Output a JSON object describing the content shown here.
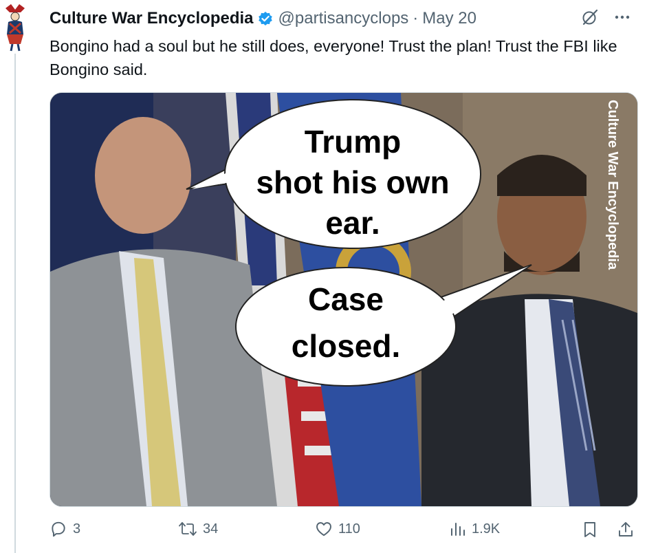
{
  "tweet": {
    "author_name": "Culture War Encyclopedia",
    "handle": "@partisancyclops",
    "separator": "·",
    "date": "May 20",
    "text": "Bongino had a soul but he still does, everyone! Trust the plan! Trust the FBI like Bongino said.",
    "verified": true,
    "accent_color": "#1d9bf0"
  },
  "media": {
    "watermark": "Culture War Encyclopedia",
    "bubble_1": [
      "Trump",
      "shot his own",
      "ear."
    ],
    "bubble_2": [
      "Case",
      "closed."
    ]
  },
  "actions": {
    "replies": "3",
    "reposts": "34",
    "likes": "110",
    "views": "1.9K"
  },
  "icons": [
    "avatar-logo-icon",
    "verified-badge-icon",
    "grok-icon",
    "more-icon",
    "reply-icon",
    "repost-icon",
    "like-icon",
    "views-icon",
    "bookmark-icon",
    "share-icon"
  ]
}
